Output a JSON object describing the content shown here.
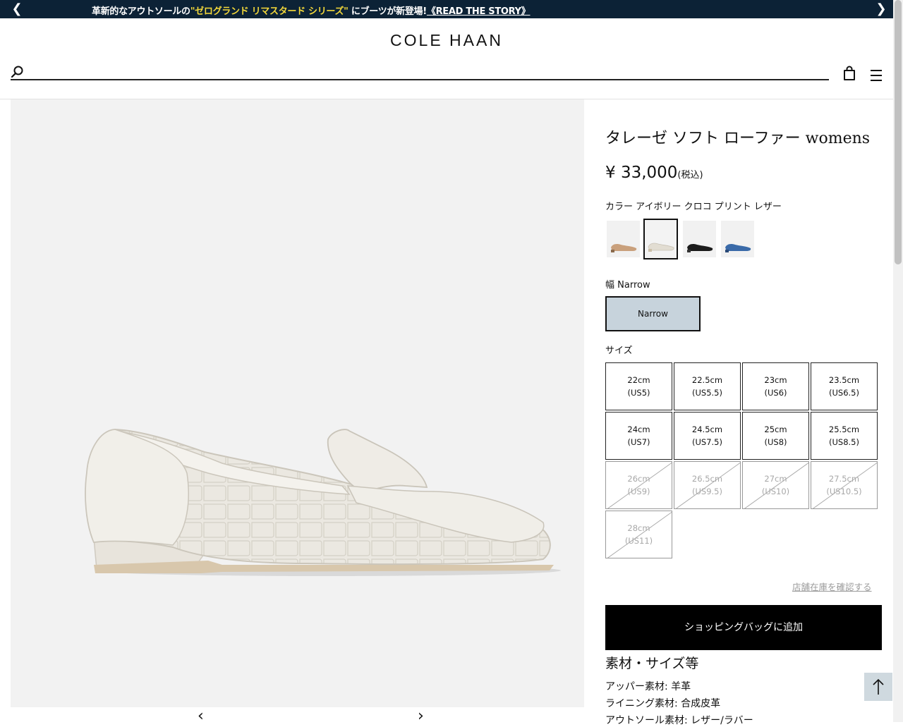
{
  "promo": {
    "prefix": "革新的なアウトソールの",
    "highlight": "\"ゼログランド リマスタード シリーズ\"",
    "middle": "にブーツが新登場!",
    "story_link": "《READ THE STORY》",
    "prev_icon": "chevron-left-icon",
    "next_icon": "chevron-right-icon",
    "background": "#0c2236",
    "highlight_color": "#f2d73a"
  },
  "header": {
    "logo": "COLE HAAN",
    "search_placeholder": "",
    "icons": [
      "search-icon",
      "shopping-bag-icon",
      "hamburger-menu-icon"
    ]
  },
  "gallery": {
    "prev": "‹",
    "next": "›",
    "image_description": "ivory croco print leather loafer"
  },
  "product": {
    "title": "タレーゼ ソフト ローファー womens",
    "price": "¥ 33,000",
    "tax_note": "(税込)",
    "color_label": "カラー アイボリー クロコ プリント レザー",
    "swatches": [
      {
        "name": "tan",
        "color": "#c9a07c",
        "selected": false
      },
      {
        "name": "ivory",
        "color": "#e6e2d9",
        "selected": true
      },
      {
        "name": "black",
        "color": "#1b1b1b",
        "selected": false
      },
      {
        "name": "blue",
        "color": "#3a6aa8",
        "selected": false
      }
    ],
    "width_label": "幅 Narrow",
    "width_option": "Narrow",
    "size_label": "サイズ",
    "sizes": [
      {
        "cm": "22cm",
        "us": "(US5)",
        "available": true
      },
      {
        "cm": "22.5cm",
        "us": "(US5.5)",
        "available": true
      },
      {
        "cm": "23cm",
        "us": "(US6)",
        "available": true
      },
      {
        "cm": "23.5cm",
        "us": "(US6.5)",
        "available": true
      },
      {
        "cm": "24cm",
        "us": "(US7)",
        "available": true
      },
      {
        "cm": "24.5cm",
        "us": "(US7.5)",
        "available": true
      },
      {
        "cm": "25cm",
        "us": "(US8)",
        "available": true
      },
      {
        "cm": "25.5cm",
        "us": "(US8.5)",
        "available": true
      },
      {
        "cm": "26cm",
        "us": "(US9)",
        "available": false
      },
      {
        "cm": "26.5cm",
        "us": "(US9.5)",
        "available": false
      },
      {
        "cm": "27cm",
        "us": "(US10)",
        "available": false
      },
      {
        "cm": "27.5cm",
        "us": "(US10.5)",
        "available": false
      },
      {
        "cm": "28cm",
        "us": "(US11)",
        "available": false
      }
    ],
    "store_stock_link": "店舗在庫を確認する",
    "add_to_bag": "ショッピングバッグに追加",
    "spec_title": "素材・サイズ等",
    "specs": [
      "アッパー素材: 羊革",
      "ライニング素材: 合成皮革",
      "アウトソール素材: レザー/ラバー"
    ]
  },
  "back_to_top_icon": "arrow-up-icon"
}
